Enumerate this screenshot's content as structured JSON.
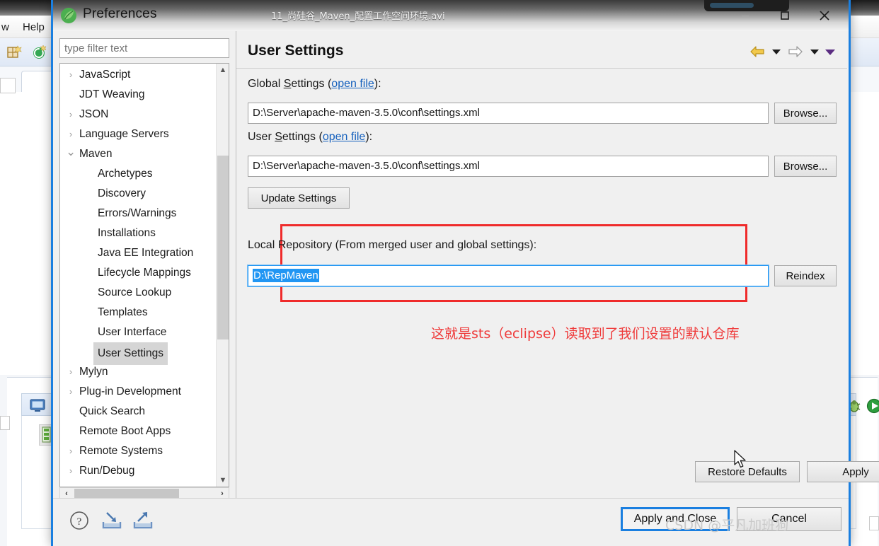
{
  "background_ide": {
    "menu_items": [
      {
        "label": "w",
        "x": 2
      },
      {
        "label": "Help",
        "x": 32
      }
    ],
    "toolbar_icons": [
      {
        "name": "perspective-icon",
        "x": 8
      },
      {
        "name": "spring-boot-icon",
        "x": 44
      }
    ],
    "bottom_view": {
      "console_icon": "console-icon",
      "debug_icon": "bug-icon",
      "run_icon": "run-icon",
      "server_icon": "server-icon"
    }
  },
  "dialog": {
    "title": "Preferences",
    "icon": "spring-leaf-icon",
    "video_title": "11_尚硅谷_Maven_配置工作空间环境.avi",
    "window_controls": {
      "minimize": "minimize-icon",
      "maximize": "maximize-icon",
      "close": "close-icon"
    }
  },
  "filter": {
    "placeholder": "type filter text",
    "value": ""
  },
  "tree": {
    "items": [
      {
        "label": "JavaScript",
        "indent": 0,
        "arrow": "collapsed",
        "selected": false
      },
      {
        "label": "JDT Weaving",
        "indent": 0,
        "arrow": "none",
        "selected": false
      },
      {
        "label": "JSON",
        "indent": 0,
        "arrow": "collapsed",
        "selected": false
      },
      {
        "label": "Language Servers",
        "indent": 0,
        "arrow": "collapsed",
        "selected": false
      },
      {
        "label": "Maven",
        "indent": 0,
        "arrow": "expanded",
        "selected": false
      },
      {
        "label": "Archetypes",
        "indent": 1,
        "arrow": "none",
        "selected": false
      },
      {
        "label": "Discovery",
        "indent": 1,
        "arrow": "none",
        "selected": false
      },
      {
        "label": "Errors/Warnings",
        "indent": 1,
        "arrow": "none",
        "selected": false
      },
      {
        "label": "Installations",
        "indent": 1,
        "arrow": "none",
        "selected": false
      },
      {
        "label": "Java EE Integration",
        "indent": 1,
        "arrow": "none",
        "selected": false
      },
      {
        "label": "Lifecycle Mappings",
        "indent": 1,
        "arrow": "none",
        "selected": false
      },
      {
        "label": "Source Lookup",
        "indent": 1,
        "arrow": "none",
        "selected": false
      },
      {
        "label": "Templates",
        "indent": 1,
        "arrow": "none",
        "selected": false
      },
      {
        "label": "User Interface",
        "indent": 1,
        "arrow": "none",
        "selected": false
      },
      {
        "label": "User Settings",
        "indent": 1,
        "arrow": "none",
        "selected": true
      },
      {
        "label": "Mylyn",
        "indent": 0,
        "arrow": "collapsed",
        "selected": false
      },
      {
        "label": "Plug-in Development",
        "indent": 0,
        "arrow": "collapsed",
        "selected": false
      },
      {
        "label": "Quick Search",
        "indent": 0,
        "arrow": "none",
        "selected": false
      },
      {
        "label": "Remote Boot Apps",
        "indent": 0,
        "arrow": "none",
        "selected": false
      },
      {
        "label": "Remote Systems",
        "indent": 0,
        "arrow": "collapsed",
        "selected": false
      },
      {
        "label": "Run/Debug",
        "indent": 0,
        "arrow": "collapsed",
        "selected": false
      }
    ]
  },
  "page": {
    "title": "User Settings",
    "nav": {
      "back": "back-arrow-icon",
      "back_menu": "chevron-down-icon",
      "forward": "forward-arrow-icon",
      "forward_menu": "chevron-down-icon",
      "view_menu": "chevron-down-icon"
    },
    "global_settings": {
      "label_prefix": "Global ",
      "label_mnemonic": "S",
      "label_rest": "ettings (",
      "link": "open file",
      "label_suffix": "):",
      "value": "D:\\Server\\apache-maven-3.5.0\\conf\\settings.xml",
      "browse": "Browse..."
    },
    "user_settings": {
      "label_prefix": "User ",
      "label_mnemonic": "S",
      "label_rest": "ettings (",
      "link": "open file",
      "label_suffix": "):",
      "value": "D:\\Server\\apache-maven-3.5.0\\conf\\settings.xml",
      "browse": "Browse..."
    },
    "update_settings_button": "Update Settings",
    "local_repository": {
      "label": "Local Repository (From merged user and global settings):",
      "value": "D:\\RepMaven",
      "value_selected": true,
      "reindex": "Reindex",
      "highlight_color": "#ef2b2b"
    },
    "annotation": {
      "text": "这就是sts（eclipse）读取到了我们设置的默认仓库",
      "color": "#ef3b3b"
    },
    "restore_defaults_button": "Restore Defaults",
    "apply_button": "Apply"
  },
  "footer": {
    "help_icon": "help-icon",
    "import_icon": "import-icon",
    "export_icon": "export-icon",
    "apply_and_close": "Apply and Close",
    "cancel": "Cancel",
    "primary_color": "#1a7fe0"
  },
  "watermark": "CSDN @平凡加班狗"
}
